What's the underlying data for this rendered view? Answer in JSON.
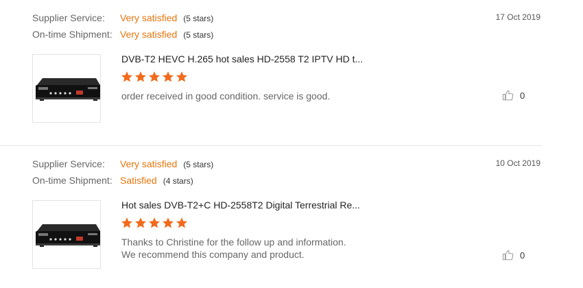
{
  "labels": {
    "supplier_service": "Supplier Service:",
    "ontime_shipment": "On-time Shipment:"
  },
  "colors": {
    "accent": "#e8750c",
    "star": "#f26a1b"
  },
  "icons": {
    "star": "star-icon",
    "like": "thumbs-up-icon",
    "product": "product-image"
  },
  "reviews": [
    {
      "supplier_service": {
        "value": "Very satisfied",
        "stars": "(5 stars)"
      },
      "ontime_shipment": {
        "value": "Very satisfied",
        "stars": "(5 stars)"
      },
      "date": "17 Oct 2019",
      "product_title": "DVB-T2 HEVC H.265 hot sales HD-2558 T2 IPTV HD t...",
      "rating": 5,
      "comment_lines": [
        "order received in good condition. service is good."
      ],
      "likes": "0"
    },
    {
      "supplier_service": {
        "value": "Very satisfied",
        "stars": "(5 stars)"
      },
      "ontime_shipment": {
        "value": "Satisfied",
        "stars": "(4 stars)"
      },
      "date": "10 Oct 2019",
      "product_title": "Hot sales DVB-T2+C HD-2558T2 Digital Terrestrial Re...",
      "rating": 5,
      "comment_lines": [
        "Thanks to Christine for the follow up and information.",
        "We recommend this company and product."
      ],
      "likes": "0"
    }
  ]
}
